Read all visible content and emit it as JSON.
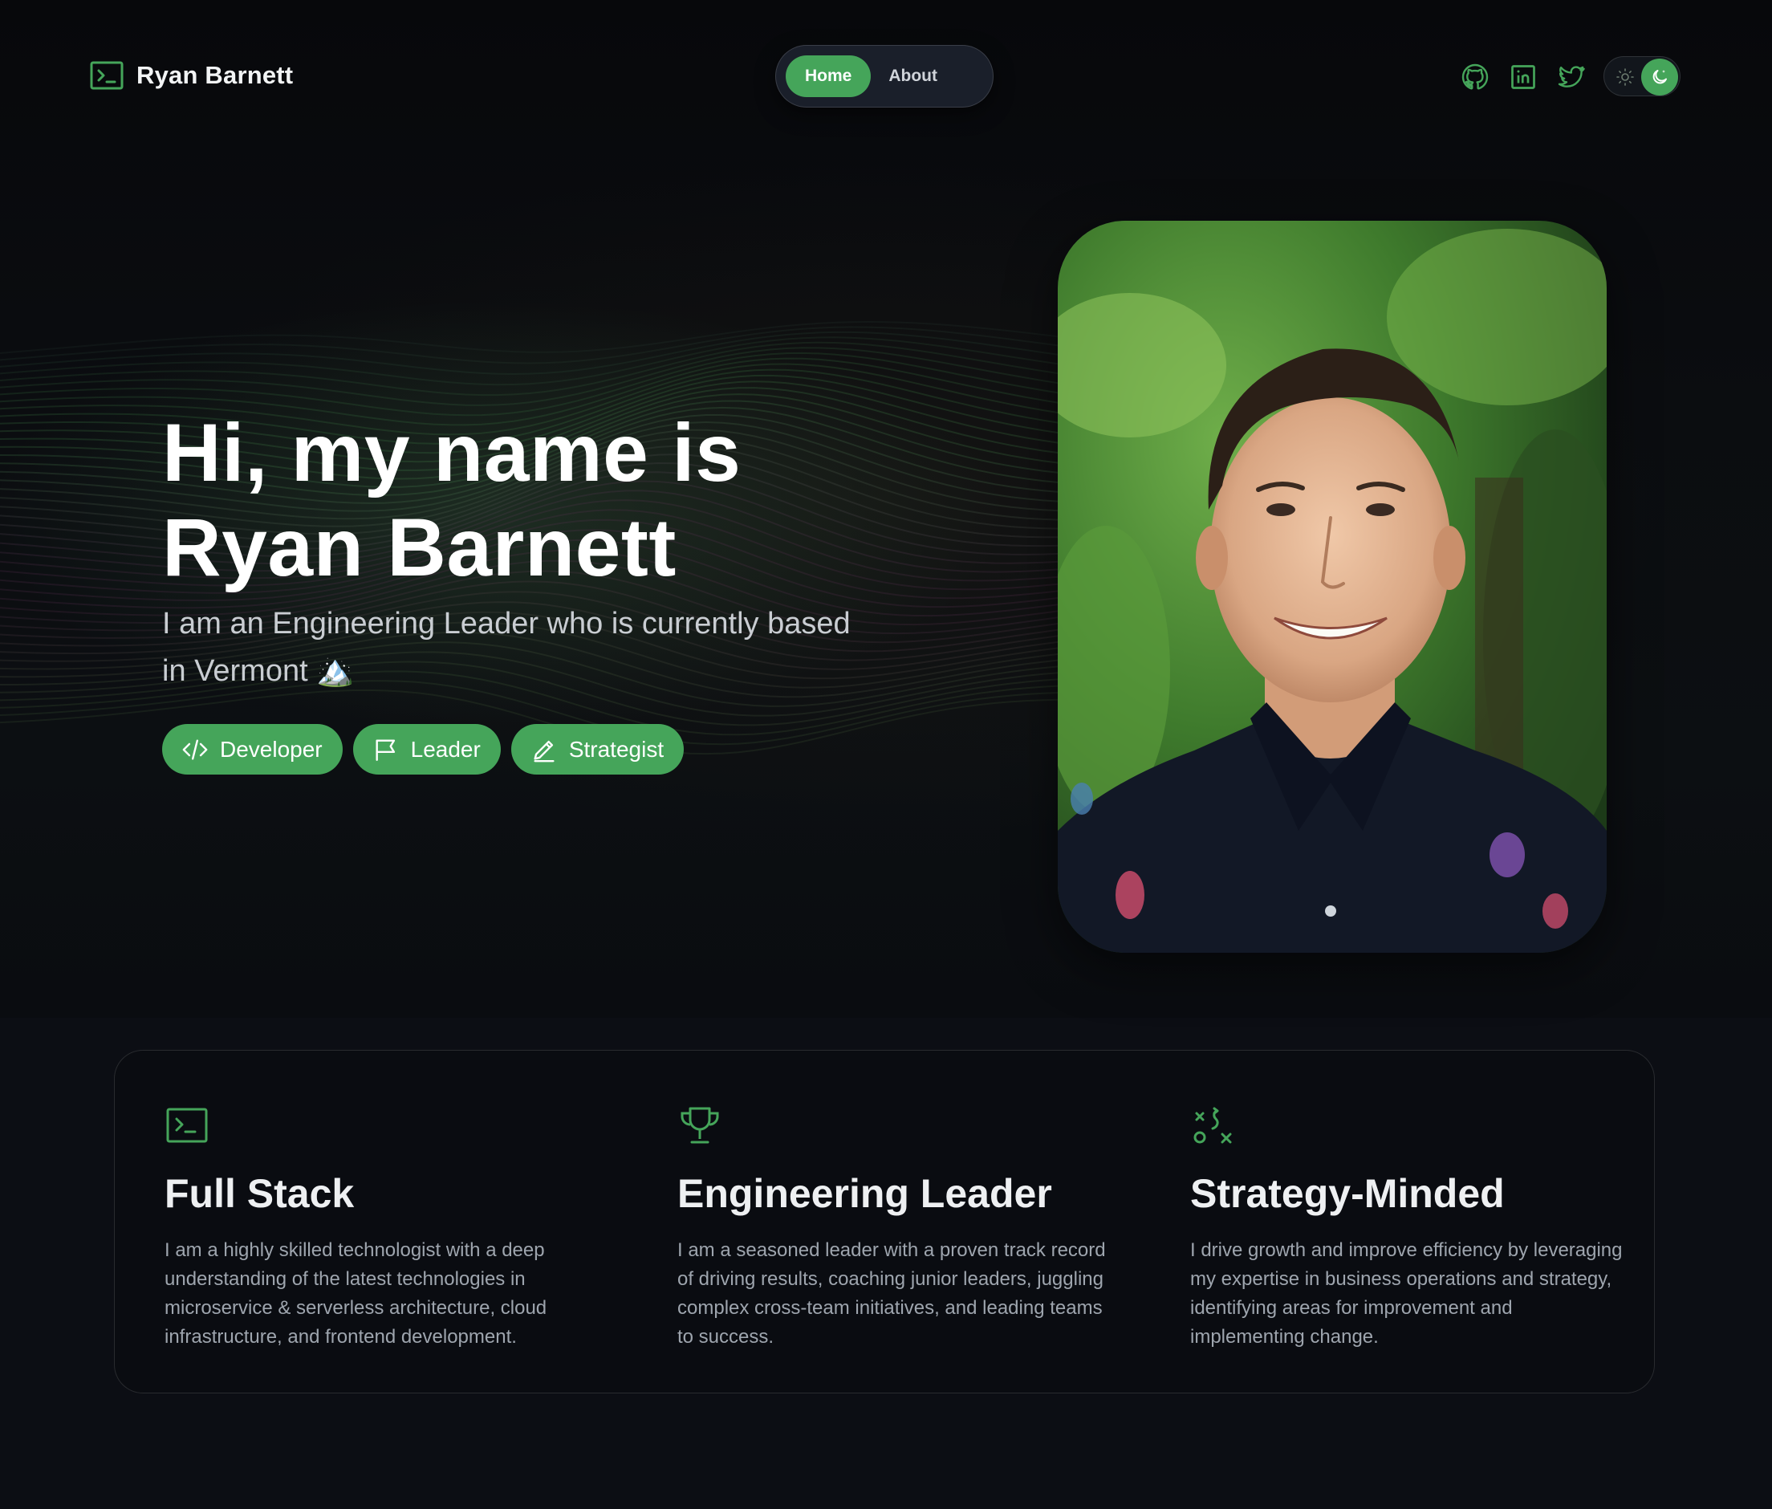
{
  "brand": {
    "name": "Ryan Barnett",
    "icon": "terminal-icon"
  },
  "nav": {
    "items": [
      {
        "label": "Home",
        "active": true
      },
      {
        "label": "About",
        "active": false
      }
    ]
  },
  "socials": [
    "github-icon",
    "linkedin-icon",
    "twitter-icon"
  ],
  "theme_toggle": {
    "icons": [
      "sun-icon",
      "moon-icon"
    ],
    "mode": "dark"
  },
  "hero": {
    "headline_line1": "Hi, my name is",
    "headline_line2": "Ryan Barnett",
    "subtitle": "I am an Engineering Leader who is currently based in Vermont 🏔️",
    "tags": [
      {
        "label": "Developer",
        "icon": "code-icon"
      },
      {
        "label": "Leader",
        "icon": "flag-icon"
      },
      {
        "label": "Strategist",
        "icon": "pencil-icon"
      }
    ]
  },
  "cards": [
    {
      "icon": "terminal-icon",
      "title": "Full Stack",
      "text": "I am a highly skilled technologist with a deep understanding of the latest technologies in microservice & serverless architecture, cloud infrastructure, and frontend development."
    },
    {
      "icon": "trophy-icon",
      "title": "Engineering Leader",
      "text": "I am a seasoned leader with a proven track record of driving results, coaching junior leaders, juggling complex cross-team initiatives, and leading teams to success."
    },
    {
      "icon": "strategy-icon",
      "title": "Strategy-Minded",
      "text": "I drive growth and improve efficiency by leveraging my expertise in business operations and strategy, identifying areas for improvement and implementing change."
    }
  ],
  "colors": {
    "accent": "#45a55a",
    "background": "#0c0e14",
    "nav_bg": "#1a1f2a",
    "body_text": "#9ea5ae"
  }
}
